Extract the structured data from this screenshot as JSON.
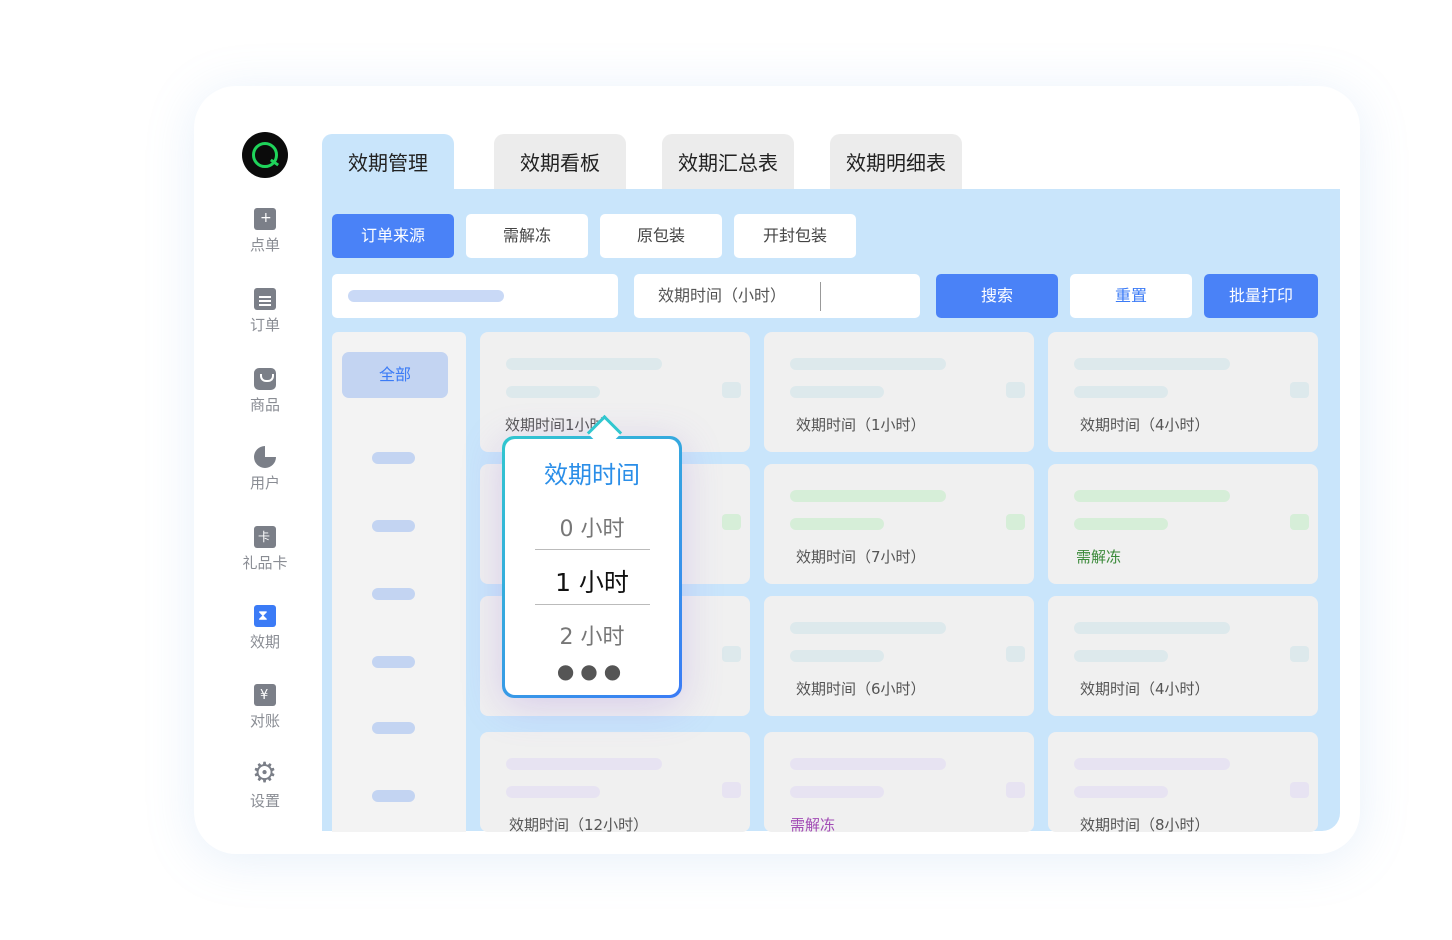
{
  "sidebar": {
    "items": [
      {
        "label": "点单",
        "icon": "file-plus-icon"
      },
      {
        "label": "订单",
        "icon": "document-list-icon"
      },
      {
        "label": "商品",
        "icon": "shopping-bag-icon"
      },
      {
        "label": "用户",
        "icon": "pie-chart-icon"
      },
      {
        "label": "礼品卡",
        "icon": "gift-card-icon"
      },
      {
        "label": "效期",
        "icon": "hourglass-calendar-icon",
        "active": true
      },
      {
        "label": "对账",
        "icon": "yen-document-icon"
      },
      {
        "label": "设置",
        "icon": "gear-icon"
      }
    ]
  },
  "tabs": [
    {
      "label": "效期管理",
      "active": true
    },
    {
      "label": "效期看板"
    },
    {
      "label": "效期汇总表"
    },
    {
      "label": "效期明细表"
    }
  ],
  "filters": {
    "types": [
      "订单来源",
      "需解冻",
      "原包装",
      "开封包装"
    ],
    "time_label": "效期时间（小时）",
    "search": "搜索",
    "reset": "重置",
    "batch_print": "批量打印"
  },
  "category": {
    "all": "全部"
  },
  "cards": [
    {
      "text": "效期时间1小时"
    },
    {
      "text": "效期时间（1小时）"
    },
    {
      "text": "效期时间（4小时）"
    },
    {
      "text": ""
    },
    {
      "text": "效期时间（7小时）"
    },
    {
      "text": "需解冻"
    },
    {
      "text": ""
    },
    {
      "text": "效期时间（6小时）"
    },
    {
      "text": "效期时间（4小时）"
    },
    {
      "text": "效期时间（12小时）"
    },
    {
      "text": "需解冻"
    },
    {
      "text": "效期时间（8小时）"
    }
  ],
  "picker": {
    "title": "效期时间",
    "options": [
      "0 小时",
      "1 小时",
      "2 小时"
    ],
    "selected": "1 小时",
    "more": "●●●"
  },
  "colors": {
    "accent": "#4a82f7",
    "panel": "#c9e5fb",
    "brand_green": "#1fd35a",
    "freeze_green": "#3b8a3a",
    "freeze_purple": "#a24bb5"
  }
}
